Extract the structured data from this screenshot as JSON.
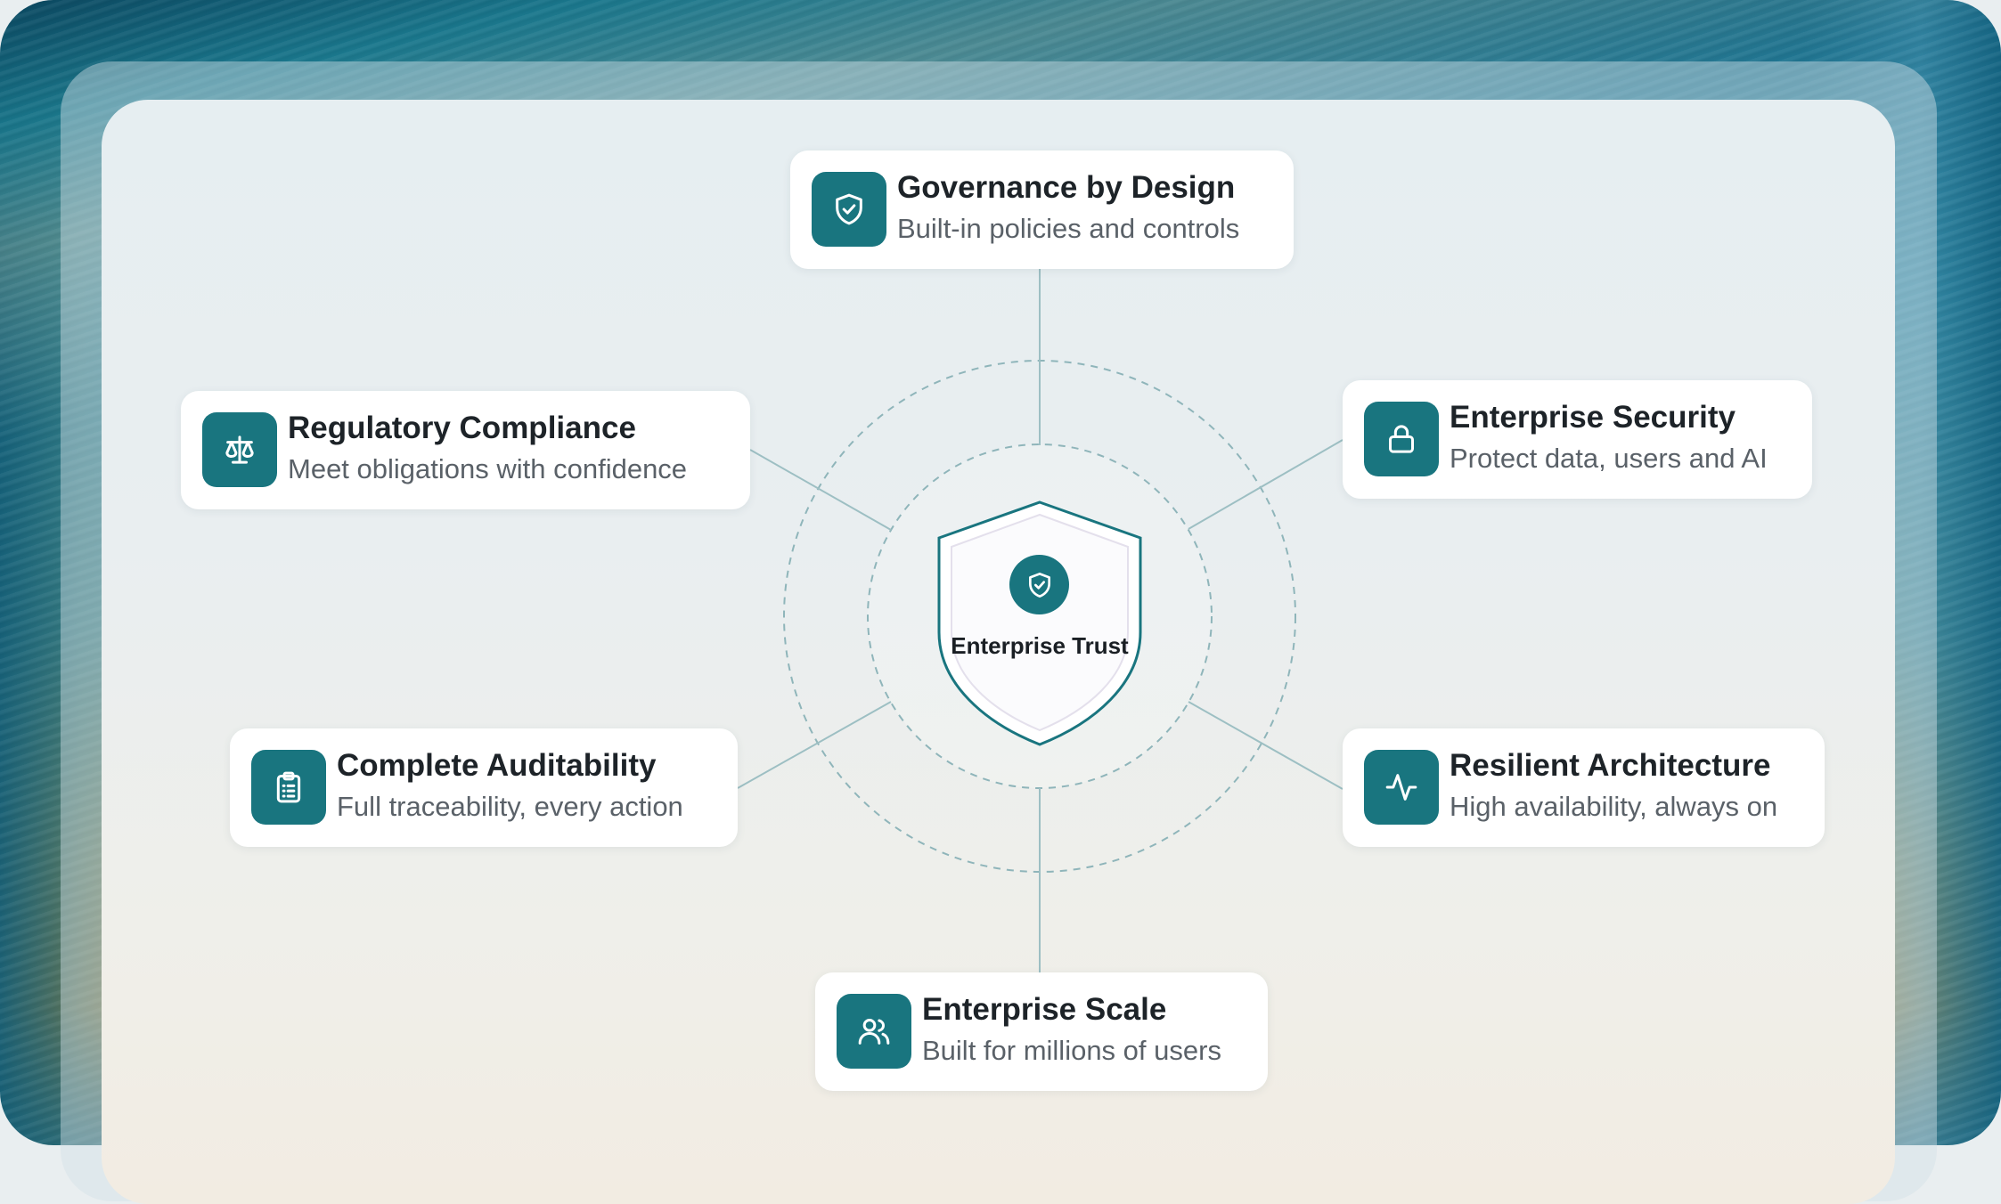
{
  "colors": {
    "accent": "#19757f",
    "card_background": "#ffffff",
    "title_text": "#1d2328",
    "subtitle_text": "#5a6168",
    "connector": "#8fb5ba"
  },
  "center": {
    "label": "Enterprise Trust",
    "icon": "shield-check-icon"
  },
  "pillars": {
    "governance": {
      "title": "Governance by Design",
      "subtitle": "Built-in policies and controls",
      "icon": "shield-check-icon"
    },
    "security": {
      "title": "Enterprise Security",
      "subtitle": "Protect data, users and AI",
      "icon": "lock-icon"
    },
    "resilience": {
      "title": "Resilient Architecture",
      "subtitle": "High availability, always on",
      "icon": "activity-pulse-icon"
    },
    "scale": {
      "title": "Enterprise Scale",
      "subtitle": "Built for millions of users",
      "icon": "users-icon"
    },
    "auditability": {
      "title": "Complete Auditability",
      "subtitle": "Full traceability, every action",
      "icon": "clipboard-list-icon"
    },
    "compliance": {
      "title": "Regulatory Compliance",
      "subtitle": "Meet obligations with confidence",
      "icon": "scales-icon"
    }
  }
}
